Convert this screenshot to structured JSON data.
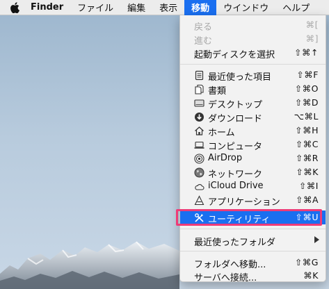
{
  "menubar": {
    "app_name": "Finder",
    "items": [
      "ファイル",
      "編集",
      "表示",
      "移動",
      "ウインドウ",
      "ヘルプ"
    ]
  },
  "go_menu": {
    "back": {
      "label": "戻る",
      "shortcut": "⌘["
    },
    "forward": {
      "label": "進む",
      "shortcut": "⌘]"
    },
    "startup_disk": {
      "label": "起動ディスクを選択",
      "shortcut": "⇧⌘↑"
    },
    "recents": {
      "label": "最近使った項目",
      "shortcut": "⇧⌘F"
    },
    "documents": {
      "label": "書類",
      "shortcut": "⇧⌘O"
    },
    "desktop": {
      "label": "デスクトップ",
      "shortcut": "⇧⌘D"
    },
    "downloads": {
      "label": "ダウンロード",
      "shortcut": "⌥⌘L"
    },
    "home": {
      "label": "ホーム",
      "shortcut": "⇧⌘H"
    },
    "computer": {
      "label": "コンピュータ",
      "shortcut": "⇧⌘C"
    },
    "airdrop": {
      "label": "AirDrop",
      "shortcut": "⇧⌘R"
    },
    "network": {
      "label": "ネットワーク",
      "shortcut": "⇧⌘K"
    },
    "icloud": {
      "label": "iCloud Drive",
      "shortcut": "⇧⌘I"
    },
    "applications": {
      "label": "アプリケーション",
      "shortcut": "⇧⌘A"
    },
    "utilities": {
      "label": "ユーティリティ",
      "shortcut": "⇧⌘U"
    },
    "recent_folders": {
      "label": "最近使ったフォルダ"
    },
    "go_to_folder": {
      "label": "フォルダへ移動...",
      "shortcut": "⇧⌘G"
    },
    "connect_server": {
      "label": "サーバへ接続...",
      "shortcut": "⌘K"
    }
  },
  "colors": {
    "accent": "#1a6ff0",
    "callout": "#ee3b78"
  }
}
